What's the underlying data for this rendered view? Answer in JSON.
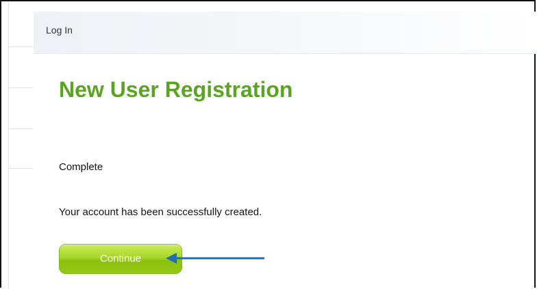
{
  "header": {
    "breadcrumb": "Log In"
  },
  "main": {
    "title": "New User Registration",
    "step_label": "Complete",
    "message": "Your account has been successfully created.",
    "continue_label": "Continue"
  },
  "annotation": {
    "arrow_color": "#1f6fb5",
    "icon": "arrow-left-icon"
  },
  "colors": {
    "title": "#5aa51f",
    "button": "#a8d62a"
  }
}
